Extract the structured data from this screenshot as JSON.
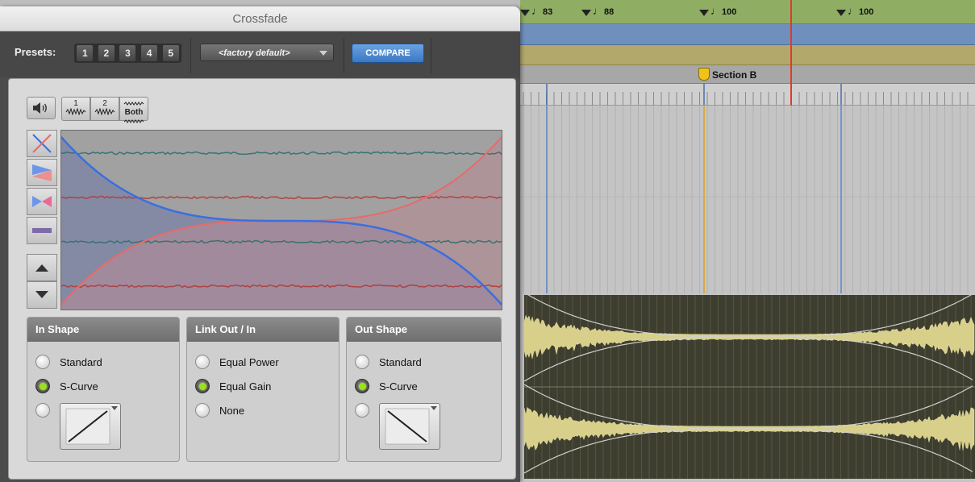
{
  "window": {
    "title": "Crossfade"
  },
  "header": {
    "presets_label": "Presets:",
    "preset_slots": [
      "1",
      "2",
      "3",
      "4",
      "5"
    ],
    "preset_name": "<factory default>",
    "compare_label": "COMPARE"
  },
  "audition": {
    "speaker_icon": "speaker-icon",
    "buttons": [
      {
        "label": "1",
        "icon": "waveform-icon"
      },
      {
        "label": "2",
        "icon": "waveform-icon"
      },
      {
        "label": "Both",
        "icon": "waveform-icon"
      }
    ]
  },
  "side_tools": [
    "crossfade-x-icon",
    "fade-in-out-icon",
    "bowtie-icon",
    "overlay-bar-icon",
    "arrow-up-icon",
    "arrow-down-icon"
  ],
  "in_shape": {
    "title": "In Shape",
    "options": [
      "Standard",
      "S-Curve"
    ],
    "selected": "S-Curve"
  },
  "link": {
    "title": "Link Out / In",
    "options": [
      "Equal Power",
      "Equal Gain",
      "None"
    ],
    "selected": "Equal Gain"
  },
  "out_shape": {
    "title": "Out Shape",
    "options": [
      "Standard",
      "S-Curve"
    ],
    "selected": "S-Curve"
  },
  "timeline": {
    "tempo_markers": [
      "83",
      "88",
      "100",
      "100"
    ],
    "section_marker": "Section B"
  },
  "colors": {
    "fade_out_curve": "#3a6fe0",
    "fade_in_curve": "#e86a6a",
    "accent_green": "#9be01e",
    "compare_blue": "#3b78c4",
    "tempo_ruler": "#8fae63",
    "playhead": "#e23a2a"
  }
}
